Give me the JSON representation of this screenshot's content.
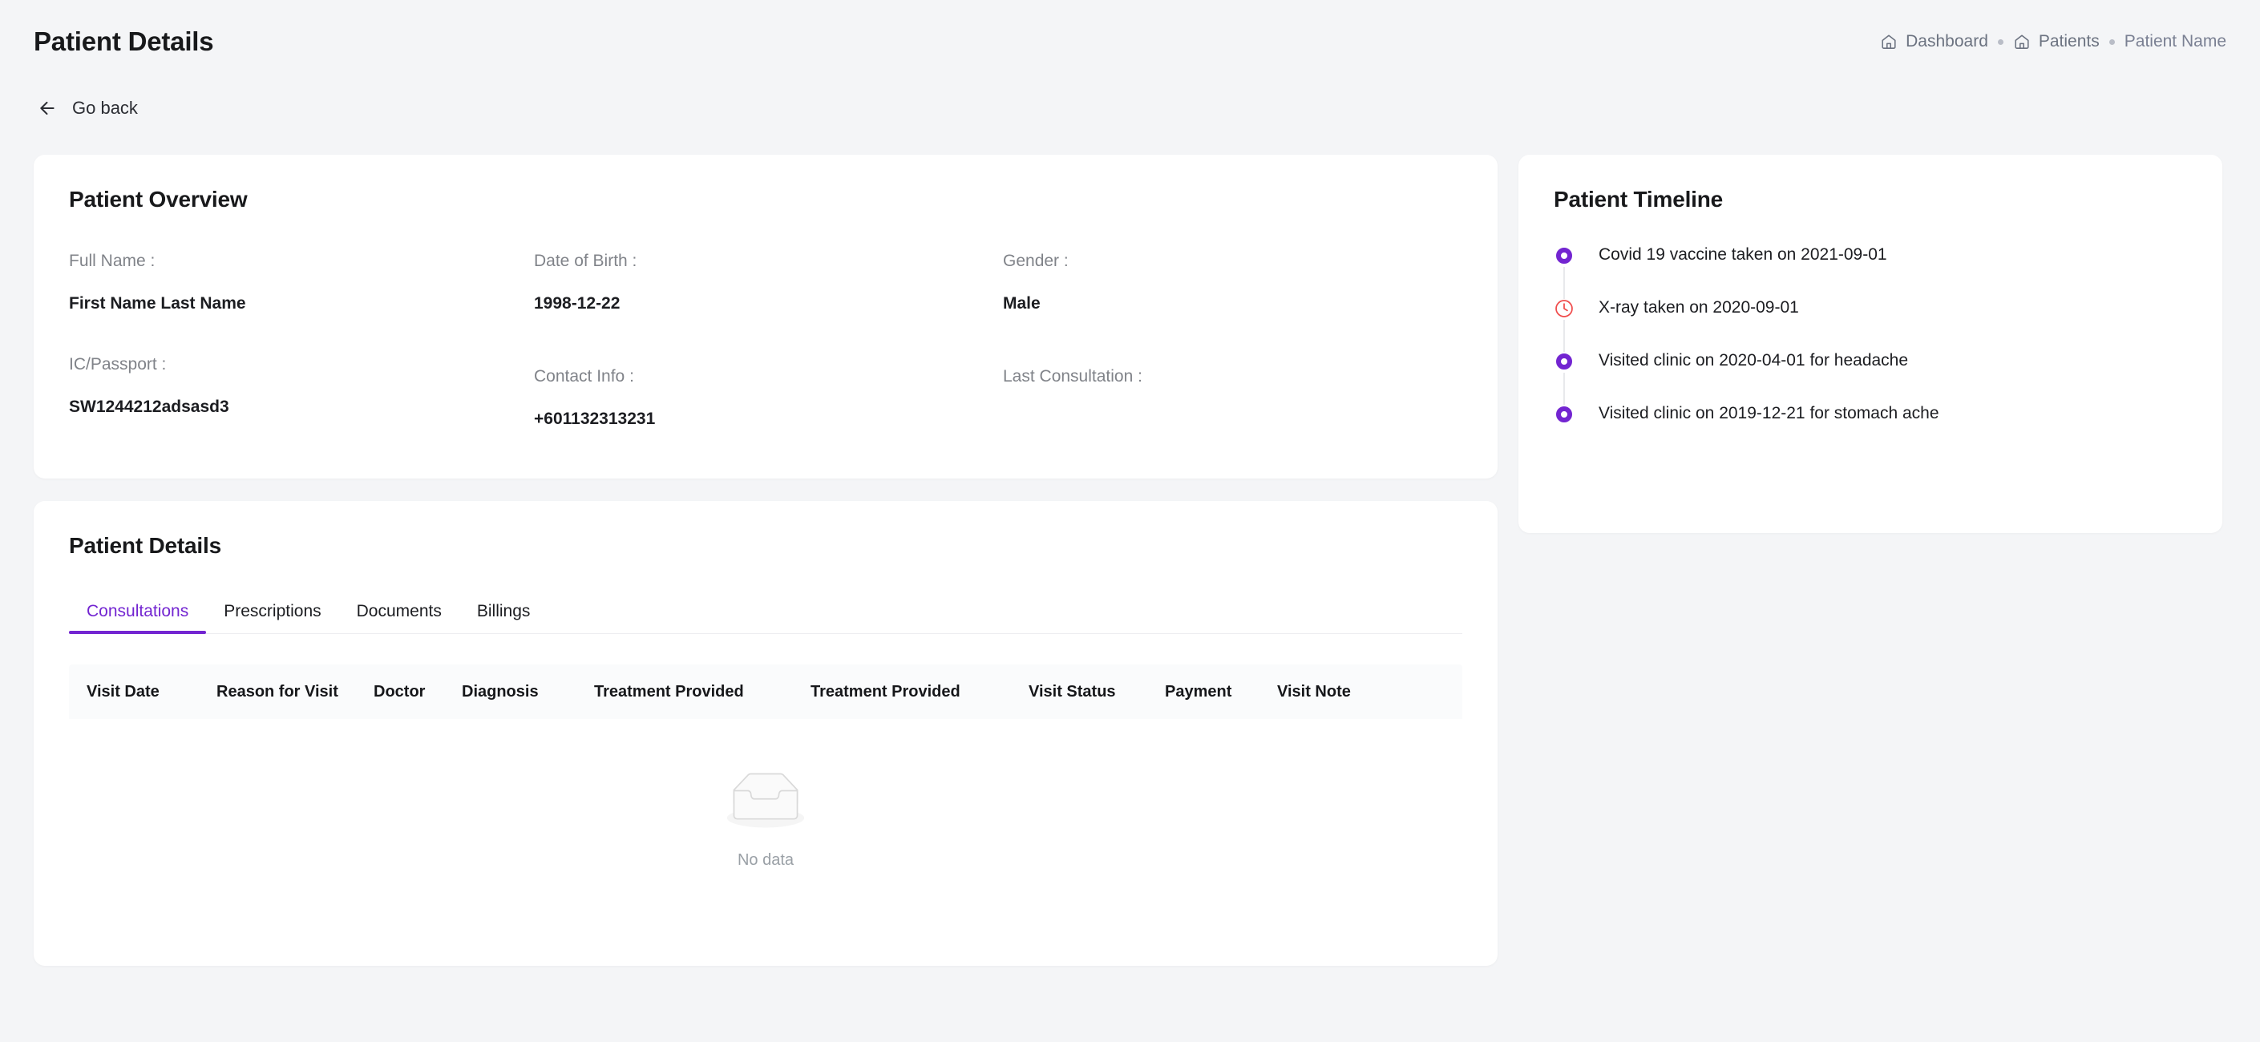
{
  "header": {
    "title": "Patient Details",
    "breadcrumb": [
      {
        "label": "Dashboard",
        "icon": "home-icon",
        "current": false
      },
      {
        "label": "Patients",
        "icon": "home-icon",
        "current": false
      },
      {
        "label": "Patient Name",
        "icon": null,
        "current": true
      }
    ]
  },
  "back": {
    "label": "Go back",
    "icon": "arrow-left-icon"
  },
  "overview": {
    "title": "Patient Overview",
    "fields": [
      {
        "label": "Full Name :",
        "value": "First Name Last Name"
      },
      {
        "label": "Date of Birth :",
        "value": "1998-12-22"
      },
      {
        "label": "Gender :",
        "value": "Male"
      },
      {
        "label": "IC/Passport :",
        "value": "SW1244212adsasd3"
      },
      {
        "label": "Contact Info :",
        "value": "+601132313231"
      },
      {
        "label": "Last Consultation :",
        "value": ""
      }
    ]
  },
  "timeline": {
    "title": "Patient Timeline",
    "items": [
      {
        "text": "Covid 19 vaccine taken on 2021-09-01",
        "marker": "dot",
        "color": "#7325d1"
      },
      {
        "text": "X-ray taken on 2020-09-01",
        "marker": "clock-icon",
        "color": "#f04b4b"
      },
      {
        "text": "Visited clinic on 2020-04-01 for headache",
        "marker": "dot",
        "color": "#7325d1"
      },
      {
        "text": "Visited clinic on 2019-12-21 for stomach ache",
        "marker": "dot",
        "color": "#7325d1"
      }
    ]
  },
  "details": {
    "title": "Patient Details",
    "tabs": [
      {
        "label": "Consultations",
        "active": true
      },
      {
        "label": "Prescriptions",
        "active": false
      },
      {
        "label": "Documents",
        "active": false
      },
      {
        "label": "Billings",
        "active": false
      }
    ],
    "table": {
      "columns": [
        "Visit Date",
        "Reason for Visit",
        "Doctor",
        "Diagnosis",
        "Treatment Provided",
        "Treatment Provided",
        "Visit Status",
        "Payment",
        "Visit Note"
      ],
      "rows": [],
      "empty_text": "No data",
      "empty_icon": "empty-inbox-icon"
    }
  },
  "colors": {
    "accent": "#7325d1",
    "page_bg": "#f4f5f7",
    "card_bg": "#ffffff",
    "text": "#1c1d21",
    "muted": "#808389",
    "danger": "#f04b4b"
  }
}
